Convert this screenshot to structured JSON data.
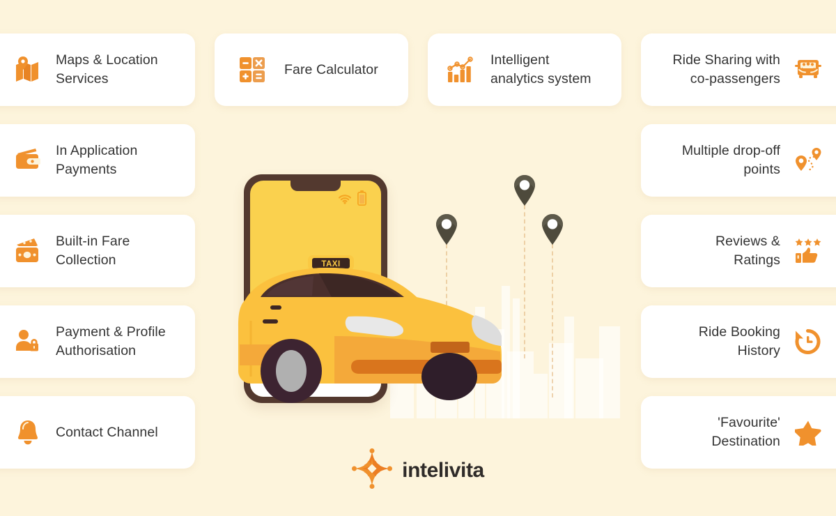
{
  "page": {
    "background_color": "#FDF4DC",
    "accent_color": "#F0912D",
    "text_color": "#333333"
  },
  "features": {
    "left_column": [
      {
        "label": "Maps & Location\nServices",
        "icon": "map-location-icon"
      },
      {
        "label": "In Application\nPayments",
        "icon": "wallet-icon"
      },
      {
        "label": "Built-in Fare\nCollection",
        "icon": "banknotes-icon"
      },
      {
        "label": "Payment & Profile\nAuthorisation",
        "icon": "user-lock-icon"
      },
      {
        "label": "Contact Channel",
        "icon": "bell-icon"
      }
    ],
    "top_middle": [
      {
        "label": "Fare Calculator",
        "icon": "calculator-icon"
      },
      {
        "label": "Intelligent\nanalytics system",
        "icon": "analytics-chart-icon"
      }
    ],
    "right_column": [
      {
        "label": "Ride Sharing with\nco-passengers",
        "icon": "shared-van-icon"
      },
      {
        "label": "Multiple drop-off\npoints",
        "icon": "route-pins-icon"
      },
      {
        "label": "Reviews &\nRatings",
        "icon": "thumbs-up-stars-icon"
      },
      {
        "label": "Ride Booking\nHistory",
        "icon": "history-clock-icon"
      },
      {
        "label": "'Favourite'\nDestination",
        "icon": "star-icon"
      }
    ]
  },
  "illustration": {
    "phone_status_icons": [
      "wifi-icon",
      "battery-icon"
    ],
    "taxi_sign_text": "TAXI",
    "map_pins_count": 3
  },
  "logo": {
    "text": "intelivita",
    "mark": "intelivita-starburst-icon"
  }
}
